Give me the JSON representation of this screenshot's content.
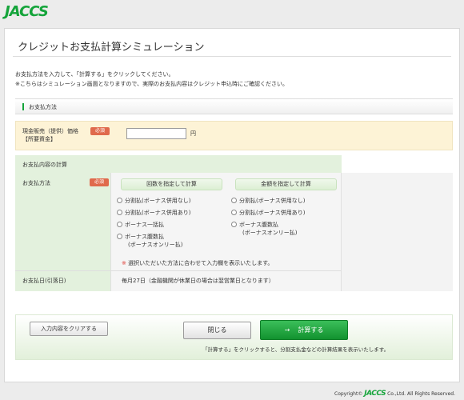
{
  "header": {
    "logo": "JACCS"
  },
  "page": {
    "title": "クレジットお支払計算シミュレーション",
    "intro_line1": "お支払方法を入力して、「計算する」をクリックしてください。",
    "intro_line2": "※こちらはシミュレーション画面となりますので、実際のお支払内容はクレジット申込時にご確認ください。"
  },
  "section": {
    "title": "お支払方法",
    "price_label_line1": "現金販売（提供）価格",
    "price_label_line2": "【所要資金】",
    "required": "必須",
    "price_value": "",
    "yen": "円"
  },
  "calc": {
    "title": "お支払内容の計算",
    "method_label": "お支払方法",
    "required": "必須",
    "col1_title": "回数を指定して計算",
    "col2_title": "金額を指定して計算",
    "col1_options": [
      "分割払(ボーナス併用なし)",
      "分割払(ボーナス併用あり)",
      "ボーナス一括払",
      "ボーナス腹数払",
      "(ボーナスオンリー払)"
    ],
    "col2_options": [
      "分割払(ボーナス併用なし)",
      "分割払(ボーナス併用あり)",
      "ボーナス腹数払",
      "(ボーナスオンリー払)"
    ],
    "note_mark": "※",
    "note": "選択いただいた方法に合わせて入力欄を表示いたします。",
    "pay_date_label": "お支払日(引落日)",
    "pay_date_value": "毎月27日（金融機関が休業日の場合は翌営業日となります）"
  },
  "actions": {
    "clear": "入力内容をクリアする",
    "close": "閉じる",
    "calc_arrow": "→",
    "calc": "計算する",
    "note": "「計算する」をクリックすると、分割支払金などの計算結果を表示いたします。"
  },
  "footer": {
    "prefix": "Copyright©",
    "logo": "JACCS",
    "suffix": "Co.,Ltd. All Rights Reserved."
  },
  "colors": {
    "brand_green": "#14a43a",
    "required_red": "#e06a4c",
    "yellow_row": "#fdf3d6"
  }
}
